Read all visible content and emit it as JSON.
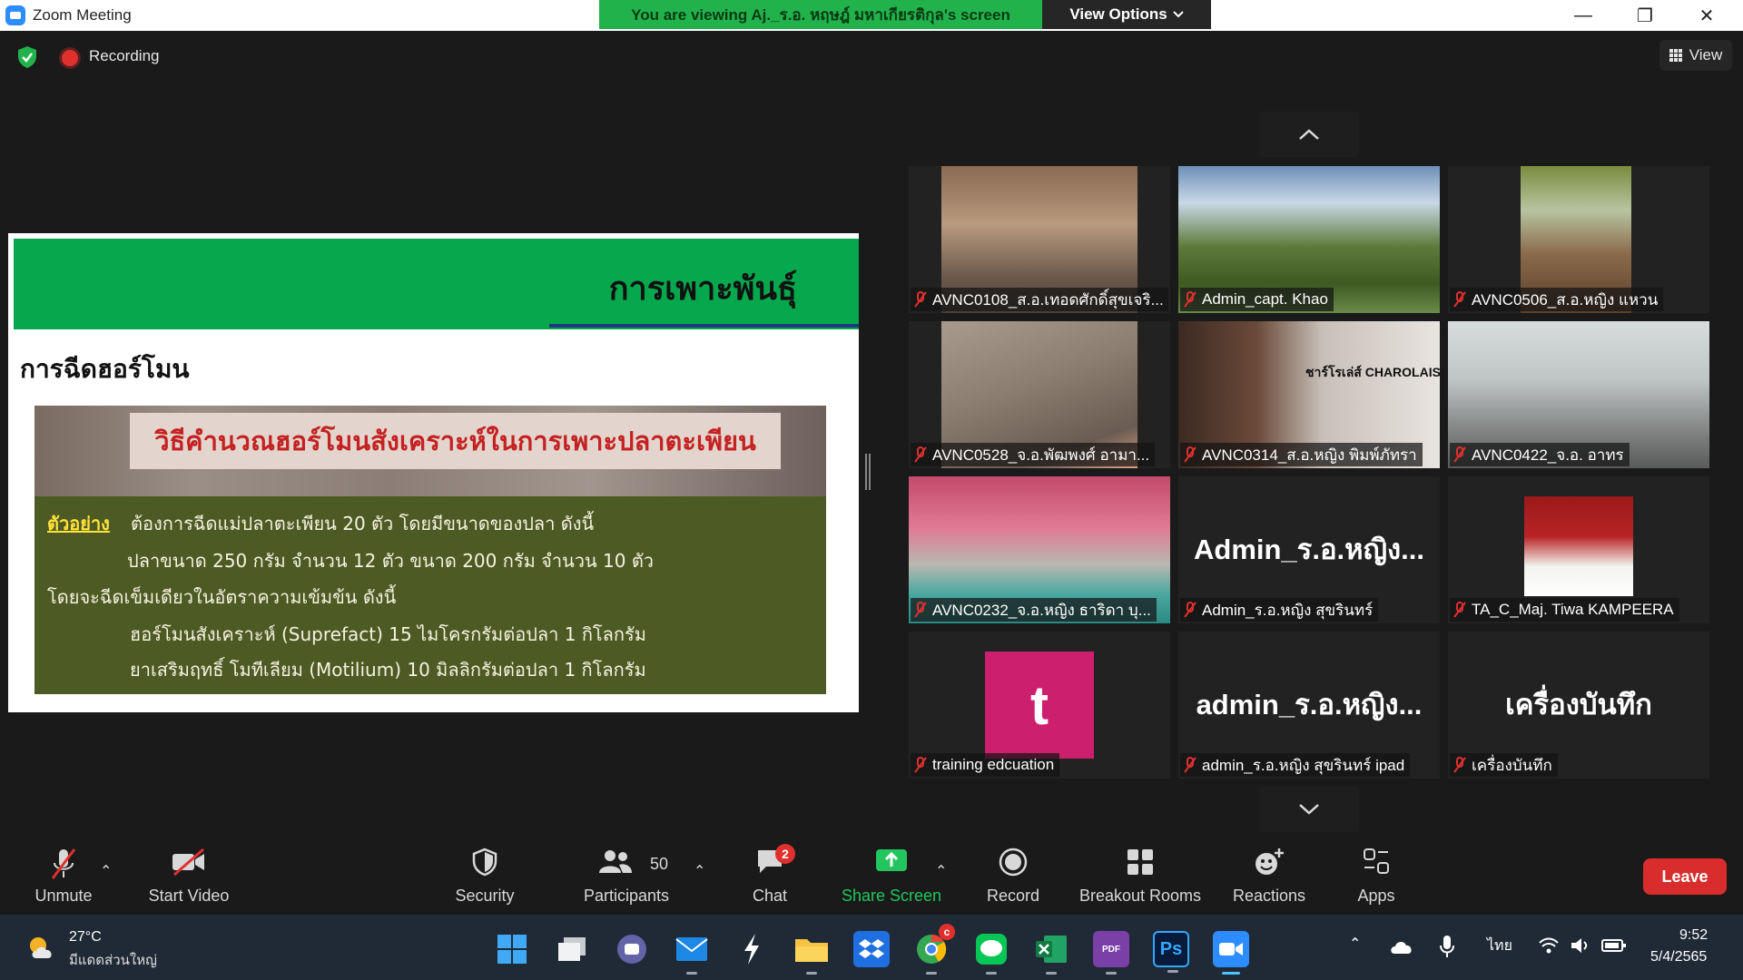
{
  "window": {
    "title": "Zoom Meeting",
    "viewing_banner": "You are viewing Aj._ร.อ. หฤษฎ์ มหาเกียรติกุล's screen",
    "view_options": "View Options",
    "minimize_glyph": "—",
    "restore_glyph": "❐",
    "close_glyph": "✕"
  },
  "meeting": {
    "recording_label": "Recording",
    "view_label": "View"
  },
  "slide": {
    "header_title": "การเพาะพันธุ์",
    "heading": "การฉีดฮอร์โมน",
    "photo_banner": "วิธีคำนวณฮอร์โมนสังเคราะห์ในการเพาะปลาตะเพียน",
    "example_label": "ตัวอย่าง",
    "lines": [
      "ต้องการฉีดแม่ปลาตะเพียน 20 ตัว โดยมีขนาดของปลา ดังนี้",
      "ปลาขนาด  250 กรัม จำนวน 12 ตัว ขนาด 200 กรัม จำนวน  10  ตัว",
      "โดยจะฉีดเข็มเดียวในอัตราความเข้มข้น ดังนี้",
      "ฮอร์โมนสังเคราะห์ (Suprefact) 15 ไมโครกรัมต่อปลา 1 กิโลกรัม",
      "ยาเสริมฤทธิ์ โมทีเลียม (Motilium) 10 มิลลิกรัมต่อปลา 1  กิโลกรัม"
    ]
  },
  "gallery": {
    "participants": [
      {
        "name": "AVNC0108_ส.อ.เทอดศักดิ์สุขเจริ..."
      },
      {
        "name": "Admin_capt. Khao"
      },
      {
        "name": "AVNC0506_ส.อ.หญิง แหวน"
      },
      {
        "name": "AVNC0528_จ.อ.พัฒพงศ์ อามา..."
      },
      {
        "name": "AVNC0314_ส.อ.หญิง พิมพ์ภัทรา"
      },
      {
        "name": "AVNC0422_จ.อ. อาทร"
      },
      {
        "name": "AVNC0232_จ.อ.หญิง ธาริดา บุ..."
      },
      {
        "name": "Admin_ร.อ.หญิง สุขรินทร์",
        "big": "Admin_ร.อ.หญิง..."
      },
      {
        "name": "TA_C_Maj. Tiwa KAMPEERA"
      },
      {
        "name": "training edcuation",
        "avatar": "t"
      },
      {
        "name": "admin_ร.อ.หญิง สุขรินทร์ ipad",
        "big": "admin_ร.อ.หญิง..."
      },
      {
        "name": "เครื่องบันทึก",
        "big": "เครื่องบันทึก"
      }
    ],
    "tile_overlay_text": "ชาร์โรเล่ส์ CHAROLAIS"
  },
  "toolbar": {
    "unmute": "Unmute",
    "start_video": "Start Video",
    "security": "Security",
    "participants": "Participants",
    "participants_count": "50",
    "chat": "Chat",
    "chat_badge": "2",
    "share_screen": "Share Screen",
    "record": "Record",
    "breakout_rooms": "Breakout Rooms",
    "reactions": "Reactions",
    "apps": "Apps",
    "leave": "Leave",
    "share_color": "#22c55e",
    "leave_color": "#d92d2d"
  },
  "taskbar": {
    "temperature": "27°C",
    "weather": "มีแดดส่วนใหญ่",
    "language": "ไทย",
    "time": "9:52",
    "date": "5/4/2565",
    "chrome_badge": "c",
    "photoshop_label": "Ps",
    "pdf_label": "PDF"
  }
}
